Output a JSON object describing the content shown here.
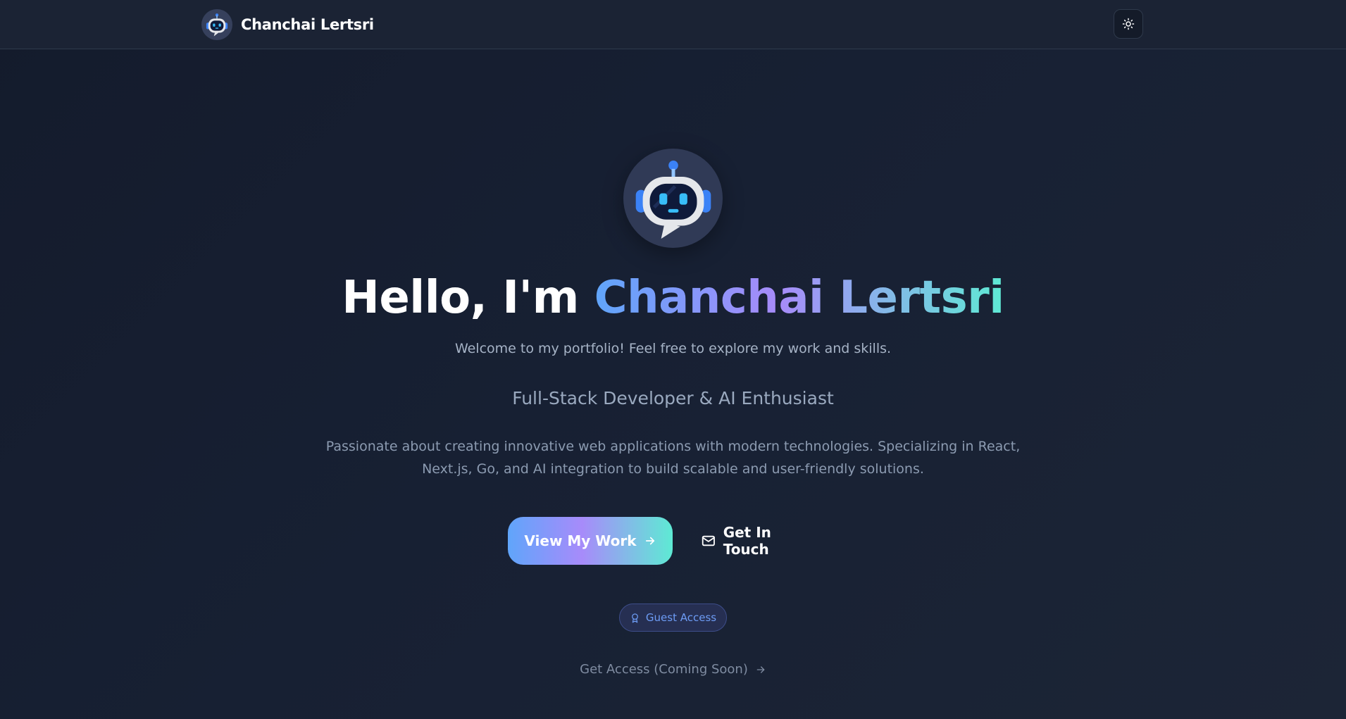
{
  "header": {
    "brand_name": "Chanchai Lertsri",
    "brand_avatar_icon": "robot-icon",
    "theme_toggle_icon": "sun-icon",
    "load_progress": 0.2
  },
  "hero": {
    "avatar_icon": "robot-icon",
    "greeting": "Hello, I'm ",
    "name": "Chanchai Lertsri",
    "welcome": "Welcome to my portfolio! Feel free to explore my work and skills.",
    "role": "Full-Stack Developer & AI Enthusiast",
    "bio": "Passionate about creating innovative web applications with modern technologies. Specializing in React, Next.js, Go, and AI integration to build scalable and user-friendly solutions.",
    "primary_button": {
      "label": "View My Work",
      "icon": "arrow-right-icon"
    },
    "secondary_button": {
      "label": "Get In Touch",
      "icon": "mail-icon"
    },
    "badge": {
      "label": "Guest Access",
      "icon": "award-icon"
    },
    "access_link": {
      "label": "Get Access (Coming Soon)",
      "icon": "arrow-right-icon"
    }
  },
  "colors": {
    "background": "#172033",
    "header_background": "#1b2334",
    "gradient_start": "#60a5fa",
    "gradient_mid": "#a78bfa",
    "gradient_end": "#5eead4",
    "badge_text": "#6d9cf5"
  }
}
